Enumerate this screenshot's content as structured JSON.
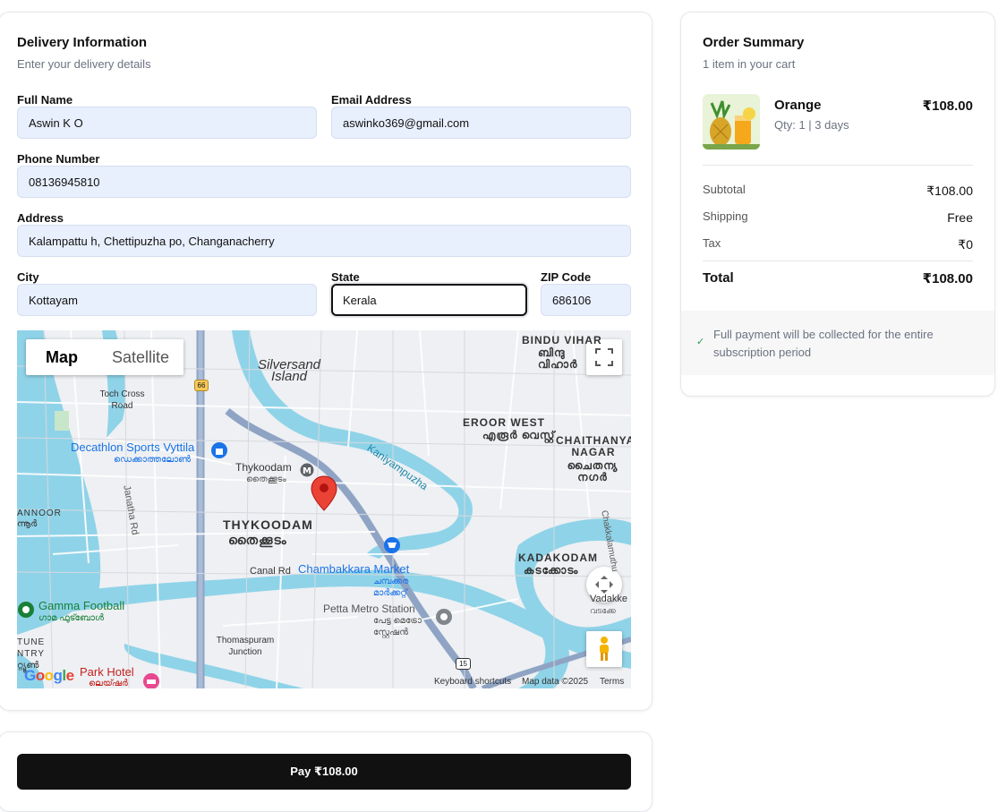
{
  "delivery": {
    "title": "Delivery Information",
    "subtitle": "Enter your delivery details",
    "fields": {
      "full_name": {
        "label": "Full Name",
        "value": "Aswin K O"
      },
      "email": {
        "label": "Email Address",
        "value": "aswinko369@gmail.com"
      },
      "phone": {
        "label": "Phone Number",
        "value": "08136945810"
      },
      "address": {
        "label": "Address",
        "value": "Kalampattu h, Chettipuzha po, Changanacherry"
      },
      "city": {
        "label": "City",
        "value": "Kottayam"
      },
      "state": {
        "label": "State",
        "value": "Kerala"
      },
      "zip": {
        "label": "ZIP Code",
        "value": "686106"
      }
    }
  },
  "map": {
    "type_buttons": {
      "map": "Map",
      "satellite": "Satellite"
    },
    "active_type": "Map",
    "labels": {
      "silversand": "Silversand Island",
      "toch_cross": "Toch Cross Road",
      "decathlon": "Decathlon Sports Vyttila",
      "decathlon_ml": "ഡെക്കാത്തലോൺ",
      "thykoodam_metro": "Thykoodam",
      "thykoodam_metro_ml": "തൈക്കൂടം",
      "thykoodam": "THYKOODAM",
      "thykoodam_ml": "തൈക്കൂടം",
      "janatha_rd": "Janatha Rd",
      "kaniyampuzha": "Kaniyampuzha",
      "eroor_west": "EROOR WEST",
      "eroor_west_ml": "എരൂർ വെസ്റ്റ്",
      "chaithanya": "CHAITHANYA NAGAR",
      "chaithanya_ml": "ചൈതന്യ നഗർ",
      "bindu_vihar": "BINDU VIHAR",
      "bindu_vihar_ml": "ബിന്ദു വിഹാർ",
      "kadakodam": "KADAKODAM",
      "kadakodam_ml": "കടക്കോടം",
      "canal_rd": "Canal Rd",
      "chambakkara": "Chambakkara Market",
      "chambakkara_ml": "ചമ്പക്കര മാർക്കറ്റ്",
      "petta": "Petta Metro Station",
      "petta_ml": "പേട്ട മെട്രോ സ്റ്റേഷൻ",
      "thomaspuram": "Thomaspuram Junction",
      "gamma": "Gamma Football",
      "gamma_ml": "ഗാമ ഫുട്ബോൾ",
      "park_hotel": "Park Hotel",
      "park_hotel_ml": "ലെയ്ഷർ",
      "annoor": "ANNOOR",
      "annoor_ml": "ന്നൂർ",
      "tune": "TUNE NTRY",
      "tune_ml": "റ്റ്യൂൺ",
      "chakkalamuthu": "Chakkalamuthu",
      "vadakke": "Vadakke",
      "vadakke_ml": "വടക്കേ",
      "route_66": "66",
      "route_15": "15"
    },
    "footer": {
      "shortcuts": "Keyboard shortcuts",
      "data": "Map data ©2025",
      "terms": "Terms"
    },
    "logo": "Google"
  },
  "summary": {
    "title": "Order Summary",
    "subtitle": "1 item in your cart",
    "item": {
      "name": "Orange",
      "qty": "Qty: 1 | 3 days",
      "price": "₹108.00"
    },
    "rows": {
      "subtotal": {
        "label": "Subtotal",
        "value": "₹108.00"
      },
      "shipping": {
        "label": "Shipping",
        "value": "Free"
      },
      "tax": {
        "label": "Tax",
        "value": "₹0"
      }
    },
    "total": {
      "label": "Total",
      "value": "₹108.00"
    },
    "note": "Full payment will be collected for the entire subscription period"
  },
  "pay": {
    "label": "Pay ₹108.00"
  },
  "colors": {
    "accent": "#111111",
    "input_bg": "#e8f0fe",
    "water": "#8fd3e8",
    "check": "#22a04b"
  }
}
